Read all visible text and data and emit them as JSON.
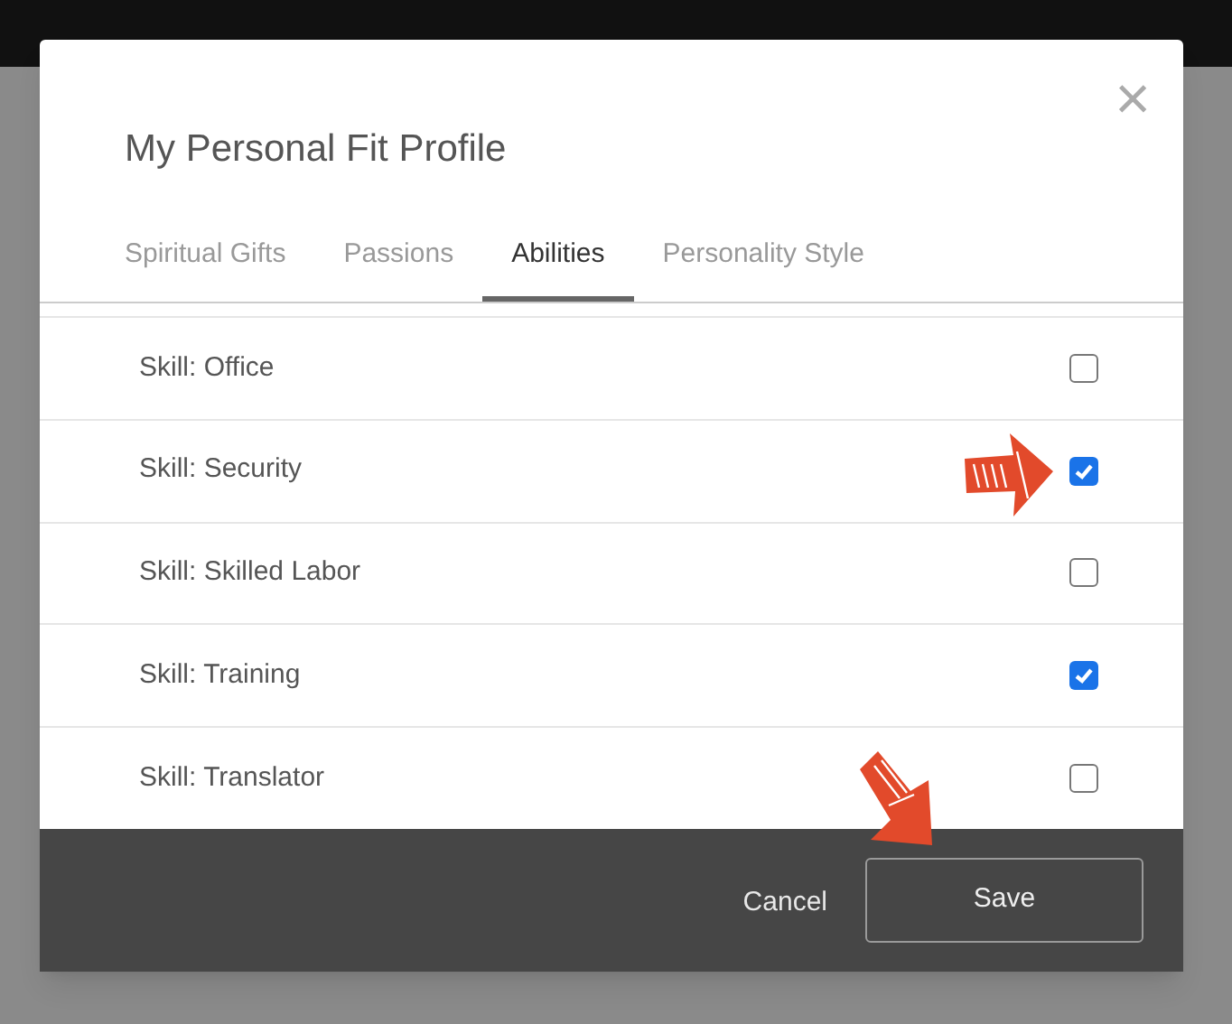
{
  "dialog": {
    "title": "My Personal Fit Profile",
    "close": "×"
  },
  "tabs": [
    {
      "label": "Spiritual Gifts",
      "selected": false
    },
    {
      "label": "Passions",
      "selected": false
    },
    {
      "label": "Abilities",
      "selected": true
    },
    {
      "label": "Personality Style",
      "selected": false
    }
  ],
  "items": [
    {
      "label": "Skill: Office",
      "checked": false
    },
    {
      "label": "Skill: Security",
      "checked": true
    },
    {
      "label": "Skill: Skilled Labor",
      "checked": false
    },
    {
      "label": "Skill: Training",
      "checked": true
    },
    {
      "label": "Skill: Translator",
      "checked": false
    }
  ],
  "buttons": {
    "cancel": "Cancel",
    "save": "Save"
  }
}
